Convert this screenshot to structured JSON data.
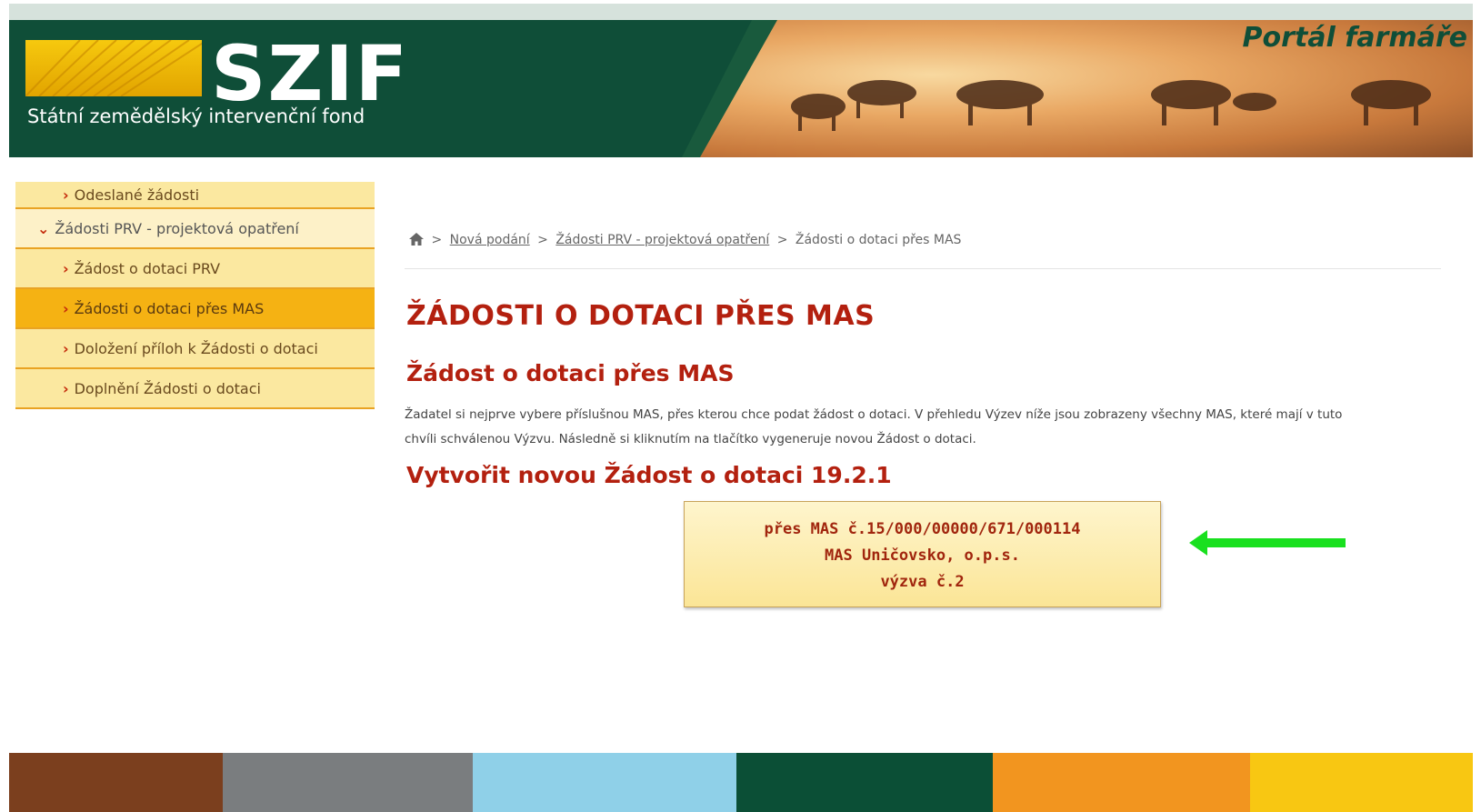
{
  "header": {
    "logo_text": "SZIF",
    "logo_subtitle": "Státní zemědělský intervenční fond",
    "portal_title": "Portál farmáře"
  },
  "sidebar": {
    "items": [
      {
        "label": "Odeslané žádosti",
        "level": 2
      },
      {
        "label": "Žádosti PRV - projektová opatření",
        "level": 1,
        "expanded": true
      },
      {
        "label": "Žádost o dotaci PRV",
        "level": 2
      },
      {
        "label": "Žádosti o dotaci přes MAS",
        "level": 2,
        "active": true
      },
      {
        "label": "Doložení příloh k Žádosti o dotaci",
        "level": 2
      },
      {
        "label": "Doplnění Žádosti o dotaci",
        "level": 2
      }
    ]
  },
  "breadcrumb": {
    "sep": ">",
    "items": [
      "Nová podání",
      "Žádosti PRV - projektová opatření",
      "Žádosti o dotaci přes MAS"
    ]
  },
  "main": {
    "page_title": "ŽÁDOSTI O DOTACI PŘES MAS",
    "subtitle": "Žádost o dotaci přes MAS",
    "description_line1": "Žadatel si nejprve vybere příslušnou MAS, přes kterou chce podat žádost o dotaci. V přehledu Výzev níže jsou zobrazeny všechny MAS, které mají v tuto",
    "description_line2": "chvíli schválenou Výzvu. Následně si kliknutím na tlačítko vygeneruje novou Žádost o dotaci.",
    "create_title": "Vytvořit novou Žádost o dotaci 19.2.1",
    "mas_button": {
      "line1": "přes MAS č.15/000/00000/671/000114",
      "line2": "MAS Uničovsko, o.p.s.",
      "line3": "výzva č.2"
    }
  },
  "colors": {
    "header_green": "#0f4e38",
    "accent_red": "#b3200f",
    "sidebar_yellow": "#fbe8a0",
    "sidebar_active": "#f5b213",
    "arrow_green": "#19e01f",
    "footer": [
      "#7b3f1e",
      "#7a7d7f",
      "#8fd0e8",
      "#0b4f36",
      "#f2951f",
      "#f8c712"
    ]
  },
  "icons": {
    "home": "home-icon",
    "chevron": "chevron-right-icon",
    "arrow": "arrow-left-icon"
  }
}
